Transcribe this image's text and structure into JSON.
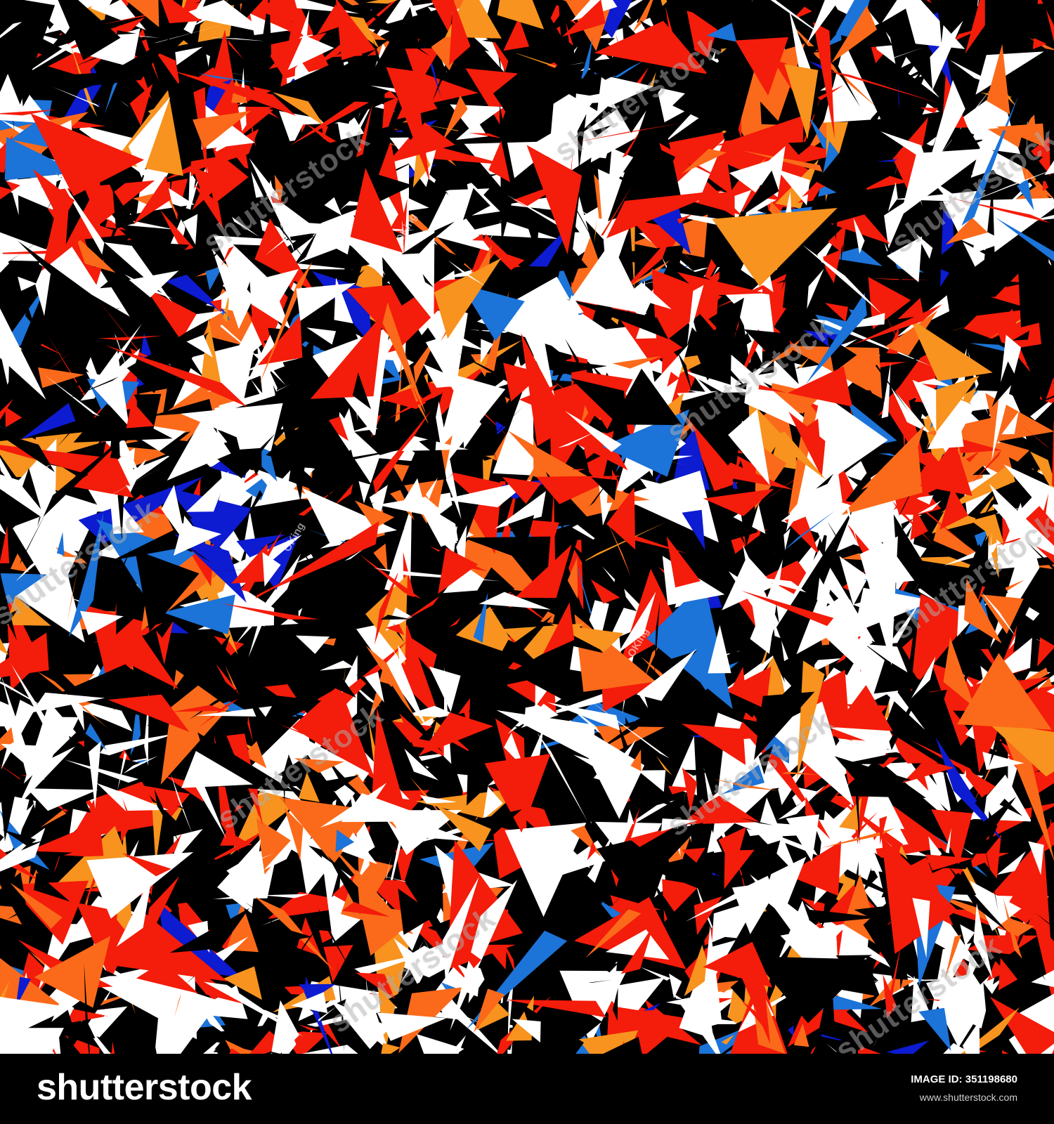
{
  "image": {
    "palette": [
      "#000000",
      "#ffffff",
      "#f41c0a",
      "#fb6a1a",
      "#f7931e",
      "#1c73d8",
      "#0d1bd1"
    ],
    "background": "#000000"
  },
  "watermark": {
    "text": "shutterstock",
    "small_text": "OKing"
  },
  "footer": {
    "brand": "shutterstock",
    "image_id_label": "IMAGE ID:",
    "image_id": "351198680",
    "url": "www.shutterstock.com"
  }
}
